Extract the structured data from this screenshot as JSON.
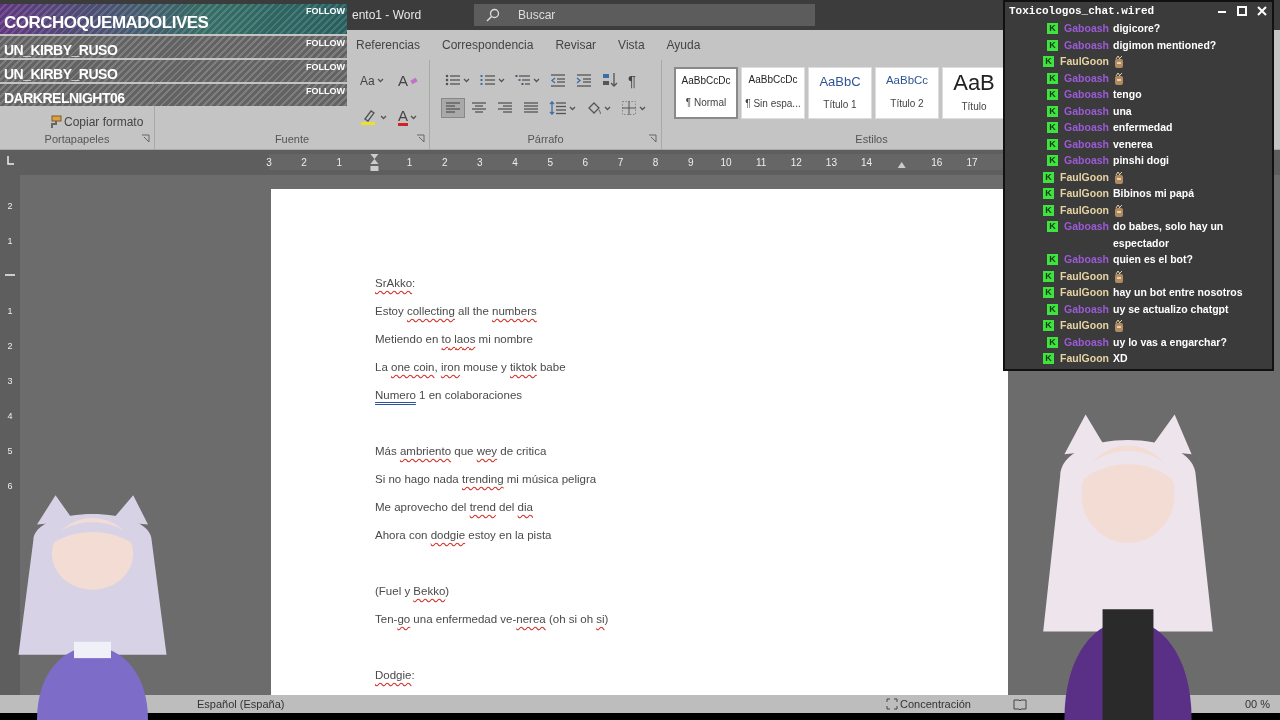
{
  "title_bar": {
    "title": "ento1 - Word",
    "search": {
      "placeholder": "Buscar"
    }
  },
  "tabs": [
    {
      "label": "Referencias",
      "selected": false
    },
    {
      "label": "Correspondencia",
      "selected": false
    },
    {
      "label": "Revisar",
      "selected": false
    },
    {
      "label": "Vista",
      "selected": false
    },
    {
      "label": "Ayuda",
      "selected": false
    }
  ],
  "ribbon": {
    "clipboard": {
      "copy_format": "Copiar formato",
      "label": "Portapapeles"
    },
    "font": {
      "label": "Fuente",
      "buttons": [
        {
          "kind": "change-case",
          "label": "Aa"
        },
        {
          "kind": "clear-format",
          "label": "A"
        },
        {
          "kind": "highlight"
        },
        {
          "kind": "font-color",
          "label": "A"
        }
      ]
    },
    "paragraph": {
      "label": "Párrafo",
      "row1": [
        {
          "kind": "bullets"
        },
        {
          "kind": "numbering"
        },
        {
          "kind": "multilevel"
        },
        {
          "kind": "outdent"
        },
        {
          "kind": "indent"
        },
        {
          "kind": "sort"
        },
        {
          "kind": "marks",
          "label": "¶"
        }
      ],
      "align": [
        {
          "kind": "left",
          "selected": true
        },
        {
          "kind": "center",
          "selected": false
        },
        {
          "kind": "right",
          "selected": false
        },
        {
          "kind": "justify",
          "selected": false
        }
      ],
      "row2": [
        {
          "kind": "line-spacing"
        },
        {
          "kind": "shading"
        },
        {
          "kind": "borders"
        }
      ]
    },
    "styles": {
      "label": "Estilos",
      "items": [
        {
          "preview": "AaBbCcDc",
          "name": "¶ Normal",
          "kind": "normal",
          "selected": true
        },
        {
          "preview": "AaBbCcDc",
          "name": "¶ Sin espa...",
          "kind": "normal",
          "selected": false
        },
        {
          "preview": "AaBbC",
          "name": "Título 1",
          "kind": "heading1",
          "selected": false
        },
        {
          "preview": "AaBbCc",
          "name": "Título 2",
          "kind": "heading2",
          "selected": false
        },
        {
          "preview": "AaB",
          "name": "Título",
          "kind": "title",
          "selected": false
        }
      ]
    }
  },
  "ruler": {
    "marks": [
      {
        "kind": "number",
        "text": "3"
      },
      {
        "kind": "number",
        "text": "2"
      },
      {
        "kind": "number",
        "text": "1"
      },
      {
        "kind": "indent"
      },
      {
        "kind": "number",
        "text": "1"
      },
      {
        "kind": "number",
        "text": "2"
      },
      {
        "kind": "number",
        "text": "3"
      },
      {
        "kind": "number",
        "text": "4"
      },
      {
        "kind": "number",
        "text": "5"
      },
      {
        "kind": "number",
        "text": "6"
      },
      {
        "kind": "number",
        "text": "7"
      },
      {
        "kind": "number",
        "text": "8"
      },
      {
        "kind": "number",
        "text": "9"
      },
      {
        "kind": "number",
        "text": "10"
      },
      {
        "kind": "number",
        "text": "11"
      },
      {
        "kind": "number",
        "text": "12"
      },
      {
        "kind": "number",
        "text": "13"
      },
      {
        "kind": "number",
        "text": "14"
      },
      {
        "kind": "tab"
      },
      {
        "kind": "number",
        "text": "16"
      },
      {
        "kind": "number",
        "text": "17"
      }
    ],
    "vertical_marks": [
      {
        "kind": "number",
        "text": "2"
      },
      {
        "kind": "number",
        "text": "1"
      },
      {
        "kind": "margin"
      },
      {
        "kind": "number",
        "text": "1"
      },
      {
        "kind": "number",
        "text": "2"
      },
      {
        "kind": "number",
        "text": "3"
      },
      {
        "kind": "number",
        "text": "4"
      },
      {
        "kind": "number",
        "text": "5"
      },
      {
        "kind": "number",
        "text": "6"
      }
    ]
  },
  "document": {
    "lines": [
      {
        "kind": "text",
        "segments": [
          {
            "text": "SrAkko",
            "kind": "spelling"
          },
          {
            "text": ":",
            "kind": "plain"
          }
        ]
      },
      {
        "kind": "text",
        "segments": [
          {
            "text": "Estoy ",
            "kind": "plain"
          },
          {
            "text": "collecting",
            "kind": "spelling"
          },
          {
            "text": " all the ",
            "kind": "plain"
          },
          {
            "text": "numbers",
            "kind": "spelling"
          }
        ]
      },
      {
        "kind": "text",
        "segments": [
          {
            "text": "Metiendo en ",
            "kind": "plain"
          },
          {
            "text": "to laos",
            "kind": "spelling"
          },
          {
            "text": " mi nombre",
            "kind": "plain"
          }
        ]
      },
      {
        "kind": "text",
        "segments": [
          {
            "text": "La ",
            "kind": "plain"
          },
          {
            "text": "one coin",
            "kind": "spelling"
          },
          {
            "text": ", ",
            "kind": "plain"
          },
          {
            "text": "iron",
            "kind": "spelling"
          },
          {
            "text": " mouse y ",
            "kind": "plain"
          },
          {
            "text": "tiktok",
            "kind": "spelling"
          },
          {
            "text": " babe",
            "kind": "plain"
          }
        ]
      },
      {
        "kind": "text",
        "segments": [
          {
            "text": "Numero",
            "kind": "grammar"
          },
          {
            "text": " 1 en colaboraciones",
            "kind": "plain"
          }
        ]
      },
      {
        "kind": "blank"
      },
      {
        "kind": "text",
        "segments": [
          {
            "text": "Más ",
            "kind": "plain"
          },
          {
            "text": "ambriento",
            "kind": "spelling"
          },
          {
            "text": " que ",
            "kind": "plain"
          },
          {
            "text": "wey",
            "kind": "spelling"
          },
          {
            "text": " de critica",
            "kind": "plain"
          }
        ]
      },
      {
        "kind": "text",
        "segments": [
          {
            "text": "Si no hago nada ",
            "kind": "plain"
          },
          {
            "text": "trending",
            "kind": "spelling"
          },
          {
            "text": " mi música peligra",
            "kind": "plain"
          }
        ]
      },
      {
        "kind": "text",
        "segments": [
          {
            "text": "Me aprovecho del ",
            "kind": "plain"
          },
          {
            "text": "trend",
            "kind": "spelling"
          },
          {
            "text": " del ",
            "kind": "plain"
          },
          {
            "text": "dia",
            "kind": "spelling"
          }
        ]
      },
      {
        "kind": "text",
        "segments": [
          {
            "text": "Ahora con ",
            "kind": "plain"
          },
          {
            "text": "dodgie",
            "kind": "spelling"
          },
          {
            "text": " estoy en la pista",
            "kind": "plain"
          }
        ]
      },
      {
        "kind": "blank"
      },
      {
        "kind": "text",
        "segments": [
          {
            "text": "(Fuel y ",
            "kind": "plain"
          },
          {
            "text": "Bekko",
            "kind": "spelling"
          },
          {
            "text": ")",
            "kind": "plain"
          }
        ]
      },
      {
        "kind": "text",
        "segments": [
          {
            "text": "Ten-",
            "kind": "plain"
          },
          {
            "text": "go",
            "kind": "spelling"
          },
          {
            "text": " una enfermedad ve-",
            "kind": "plain"
          },
          {
            "text": "nerea",
            "kind": "spelling"
          },
          {
            "text": " (oh si oh ",
            "kind": "plain"
          },
          {
            "text": "si",
            "kind": "spelling"
          },
          {
            "text": ")",
            "kind": "plain"
          }
        ]
      },
      {
        "kind": "blank"
      },
      {
        "kind": "text",
        "segments": [
          {
            "text": "Dodgie",
            "kind": "spelling"
          },
          {
            "text": ":",
            "kind": "plain"
          }
        ]
      }
    ]
  },
  "status_bar": {
    "language": "Español (España)",
    "focus": "Concentración",
    "zoom": "00 %"
  },
  "follows": [
    {
      "name": "CORCHOQUEMADOLIVES",
      "action": "FOLLOW",
      "highlighted": true
    },
    {
      "name": "UN_KIRBY_RUSO",
      "action": "FOLLOW",
      "highlighted": false
    },
    {
      "name": "UN_KIRBY_RUSO",
      "action": "FOLLOW",
      "highlighted": false
    },
    {
      "name": "DARKRELNIGHT06",
      "action": "FOLLOW",
      "highlighted": false
    }
  ],
  "chat": {
    "title": "Toxicologos_chat.wired",
    "messages": [
      {
        "badge": "K",
        "user": "Gaboash",
        "color": "#9b5ad6",
        "kind": "text",
        "text": "digicore?"
      },
      {
        "badge": "K",
        "user": "Gaboash",
        "color": "#9b5ad6",
        "kind": "text",
        "text": "digimon mentioned?"
      },
      {
        "badge": "K",
        "user": "FaulGoon",
        "color": "#e6d3a3",
        "kind": "emote"
      },
      {
        "badge": "K",
        "user": "Gaboash",
        "color": "#9b5ad6",
        "kind": "emote"
      },
      {
        "badge": "K",
        "user": "Gaboash",
        "color": "#9b5ad6",
        "kind": "text",
        "text": "tengo"
      },
      {
        "badge": "K",
        "user": "Gaboash",
        "color": "#9b5ad6",
        "kind": "text",
        "text": "una"
      },
      {
        "badge": "K",
        "user": "Gaboash",
        "color": "#9b5ad6",
        "kind": "text",
        "text": "enfermedad"
      },
      {
        "badge": "K",
        "user": "Gaboash",
        "color": "#9b5ad6",
        "kind": "text",
        "text": "venerea"
      },
      {
        "badge": "K",
        "user": "Gaboash",
        "color": "#9b5ad6",
        "kind": "text",
        "text": "pinshi dogi"
      },
      {
        "badge": "K",
        "user": "FaulGoon",
        "color": "#e6d3a3",
        "kind": "emote"
      },
      {
        "badge": "K",
        "user": "FaulGoon",
        "color": "#e6d3a3",
        "kind": "text",
        "text": "Bibinos mi papá"
      },
      {
        "badge": "K",
        "user": "FaulGoon",
        "color": "#e6d3a3",
        "kind": "emote"
      },
      {
        "badge": "K",
        "user": "Gaboash",
        "color": "#9b5ad6",
        "kind": "text",
        "text": "do babes, solo hay un espectador"
      },
      {
        "badge": "K",
        "user": "Gaboash",
        "color": "#9b5ad6",
        "kind": "text",
        "text": "quien es el bot?"
      },
      {
        "badge": "K",
        "user": "FaulGoon",
        "color": "#e6d3a3",
        "kind": "emote"
      },
      {
        "badge": "K",
        "user": "FaulGoon",
        "color": "#e6d3a3",
        "kind": "text",
        "text": "hay un bot entre nosotros"
      },
      {
        "badge": "K",
        "user": "Gaboash",
        "color": "#9b5ad6",
        "kind": "text",
        "text": "uy se actualizo chatgpt"
      },
      {
        "badge": "K",
        "user": "FaulGoon",
        "color": "#e6d3a3",
        "kind": "emote"
      },
      {
        "badge": "K",
        "user": "Gaboash",
        "color": "#9b5ad6",
        "kind": "text",
        "text": "uy lo vas a engarchar?"
      },
      {
        "badge": "K",
        "user": "FaulGoon",
        "color": "#e6d3a3",
        "kind": "text",
        "text": "XD"
      }
    ]
  }
}
